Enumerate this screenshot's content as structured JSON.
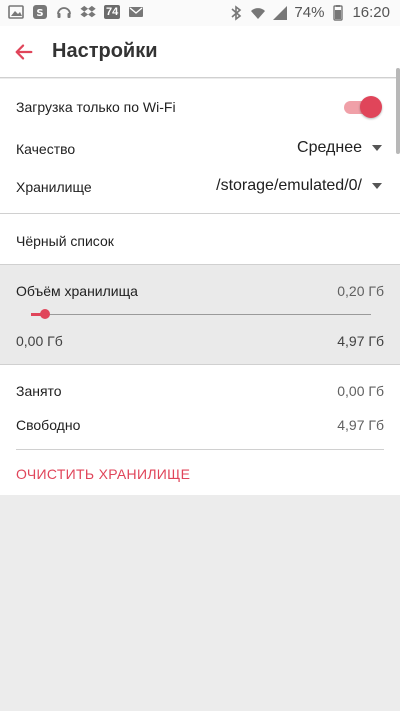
{
  "status_bar": {
    "battery": "74%",
    "time": "16:20",
    "badge": "74",
    "icons": [
      "image-icon",
      "s-app-icon",
      "headphones-icon",
      "dropbox-icon",
      "badge-icon",
      "mail-icon",
      "bluetooth-icon",
      "wifi-icon",
      "signal-icon",
      "battery-icon"
    ]
  },
  "app_bar": {
    "title": "Настройки",
    "back_icon": "arrow-back-icon"
  },
  "settings": {
    "wifi_only": {
      "label": "Загрузка только по Wi-Fi",
      "enabled": true
    },
    "quality": {
      "label": "Качество",
      "value": "Среднее"
    },
    "storage": {
      "label": "Хранилище",
      "value": "/storage/emulated/0/"
    },
    "blacklist": {
      "label": "Чёрный список"
    },
    "storage_size": {
      "label": "Объём хранилища",
      "value": "0,20 Гб",
      "min": "0,00 Гб",
      "max": "4,97 Гб",
      "fraction": 0.04
    },
    "used": {
      "label": "Занято",
      "value": "0,00 Гб"
    },
    "free": {
      "label": "Свободно",
      "value": "4,97 Гб"
    },
    "clear_button": "ОЧИСТИТЬ ХРАНИЛИЩЕ"
  },
  "colors": {
    "accent": "#e0455a",
    "accent_light": "#f0a0a8"
  }
}
